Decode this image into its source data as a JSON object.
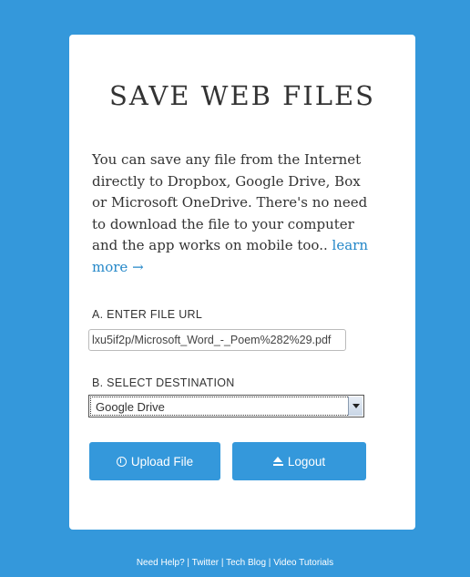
{
  "card": {
    "title": "SAVE WEB FILES",
    "intro_text": "You can save any file from the Internet directly to Dropbox, Google Drive, Box or Microsoft OneDrive. There's no need to download the file to your computer and the app works on mobile too..",
    "learn_more": "learn more →"
  },
  "form": {
    "url_label": "A. ENTER FILE URL",
    "url_value": "lxu5if2p/Microsoft_Word_-_Poem%282%29.pdf",
    "destination_label": "B. SELECT DESTINATION",
    "destination_selected": "Google Drive",
    "upload_button": "Upload File",
    "logout_button": "Logout"
  },
  "footer": {
    "need_help": "Need Help?",
    "twitter": "Twitter",
    "tech_blog": "Tech Blog",
    "video_tutorials": "Video Tutorials",
    "separator": "|"
  },
  "colors": {
    "background": "#3498db",
    "button": "#3498db",
    "link": "#2487c8"
  },
  "icons": {
    "upload": "circle-arrow-up-icon",
    "logout": "eject-icon",
    "dropdown": "chevron-down-icon"
  }
}
